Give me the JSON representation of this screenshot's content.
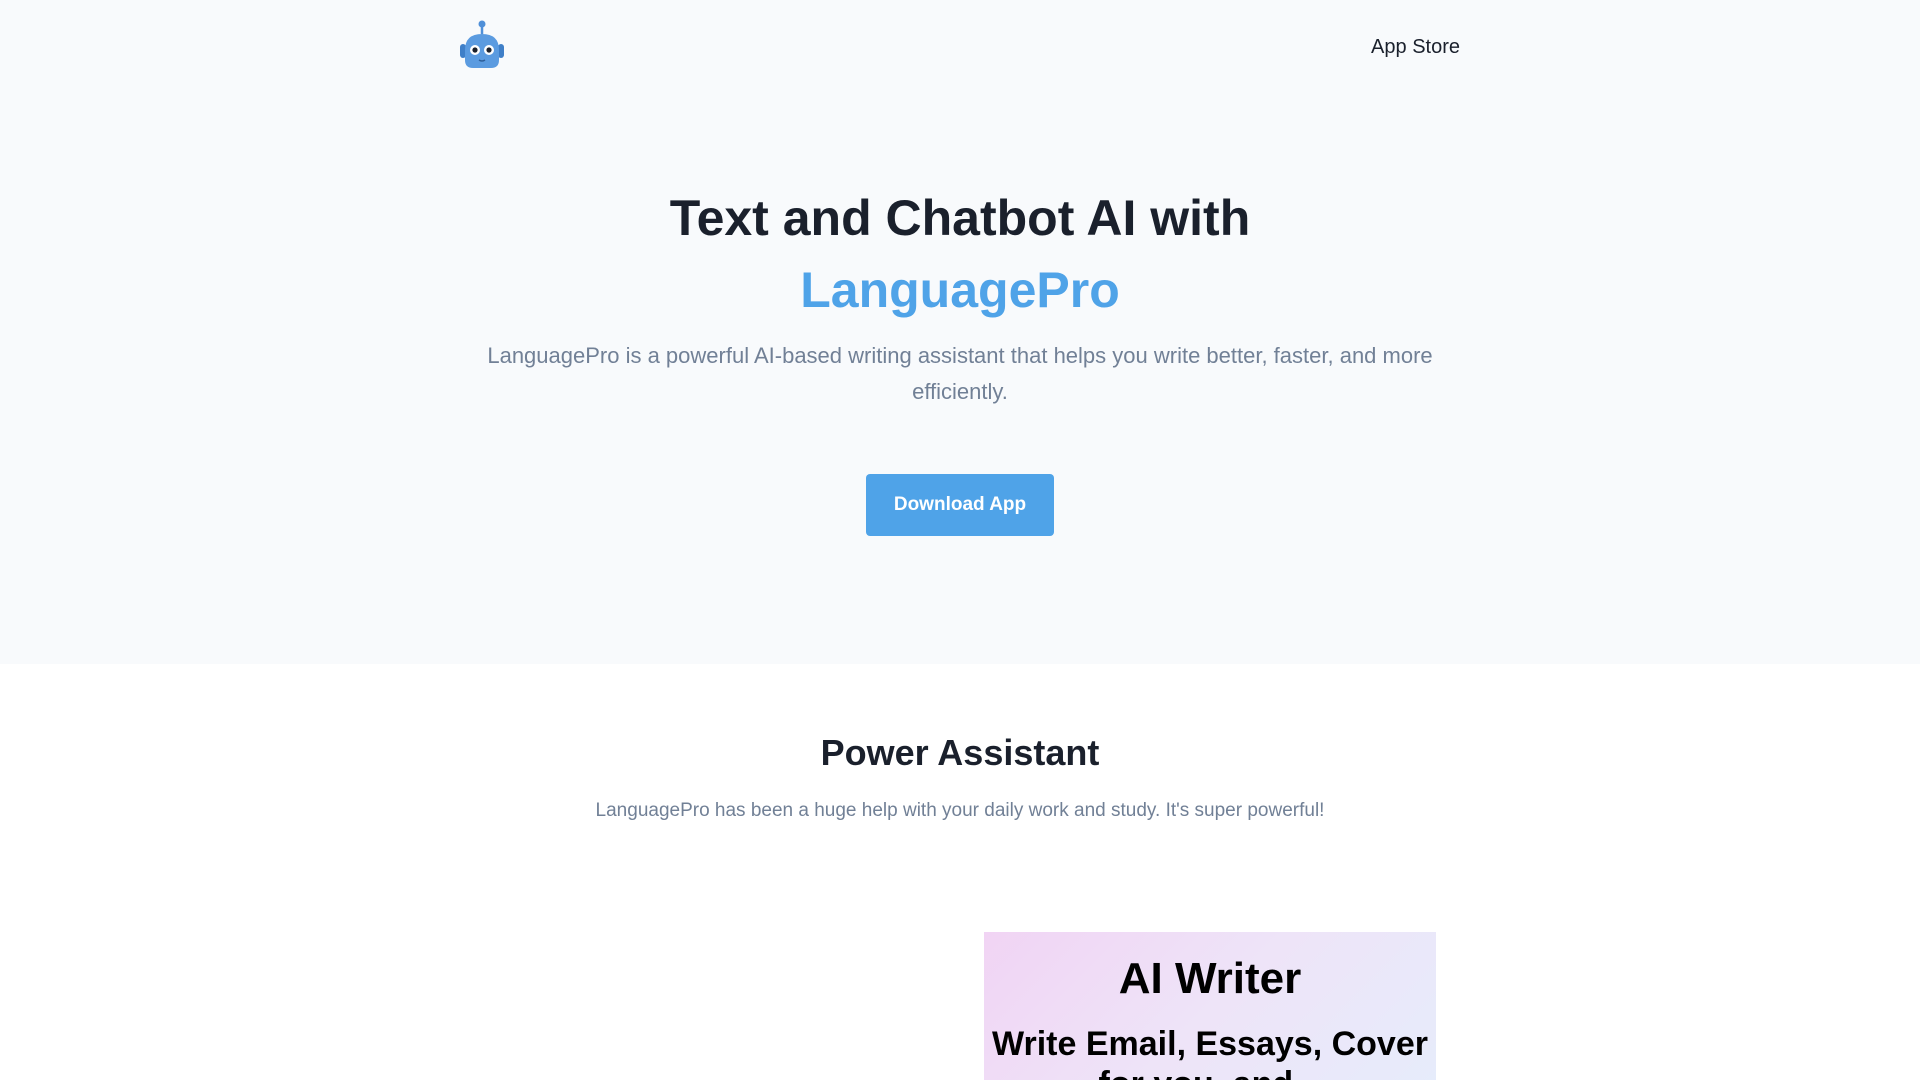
{
  "nav": {
    "logo_icon": "robot-icon",
    "app_store_label": "App Store"
  },
  "hero": {
    "title_line1": "Text and Chatbot AI with",
    "title_line2": "LanguagePro",
    "description": "LanguagePro is a powerful AI-based writing assistant that helps you write better, faster, and more efficiently.",
    "download_label": "Download App"
  },
  "section": {
    "title": "Power Assistant",
    "subtitle": "LanguagePro has been a huge help with your daily work and study. It's super powerful!"
  },
  "promo": {
    "title": "AI Writer",
    "subtitle": "Write Email, Essays, Cover for you, and..."
  },
  "colors": {
    "accent": "#4fa3e8",
    "hero_bg": "#f8fafc",
    "text_dark": "#1a202c",
    "text_muted": "#718096"
  }
}
